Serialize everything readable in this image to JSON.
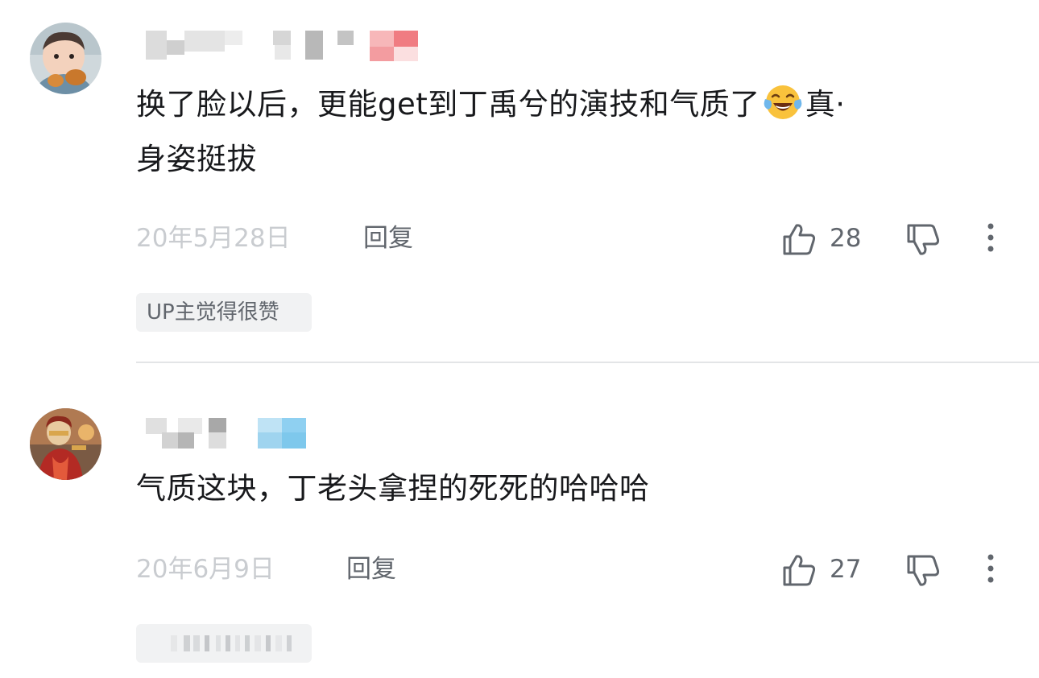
{
  "comments": [
    {
      "text_line1": "换了脸以后，更能get到丁禹兮的演技和气质了",
      "text_line1_suffix": "真·",
      "text_line2": "身姿挺拔",
      "emoji": "laughing-tears-emoji",
      "date": "20年5月28日",
      "reply_label": "回复",
      "like_count": "28",
      "tag": "UP主觉得很赞",
      "icons": [
        "thumbs-up-icon",
        "thumbs-down-icon",
        "more-vertical-icon"
      ]
    },
    {
      "text_line1": "气质这块，丁老头拿捏的死死的哈哈哈",
      "date": "20年6月9日",
      "reply_label": "回复",
      "like_count": "27",
      "icons": [
        "thumbs-up-icon",
        "thumbs-down-icon",
        "more-vertical-icon"
      ]
    }
  ],
  "colors": {
    "text": "#18191c",
    "secondary": "#61666d",
    "muted": "#c9ccd0",
    "tag_bg": "#f1f2f3",
    "divider": "#e3e5e7",
    "censor_pink": "#f07c82",
    "censor_blue": "#7ec8ec"
  }
}
